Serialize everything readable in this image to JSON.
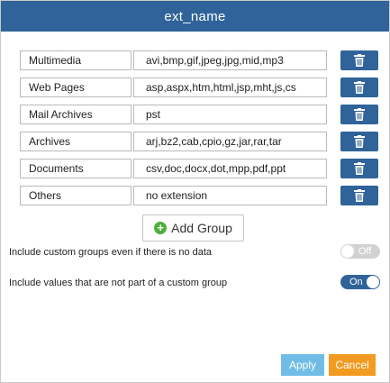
{
  "dialog": {
    "title": "ext_name"
  },
  "groups": [
    {
      "name": "Multimedia",
      "value": "avi,bmp,gif,jpeg,jpg,mid,mp3"
    },
    {
      "name": "Web Pages",
      "value": "asp,aspx,htm,html,jsp,mht,js,cs"
    },
    {
      "name": "Mail Archives",
      "value": "pst"
    },
    {
      "name": "Archives",
      "value": "arj,bz2,cab,cpio,gz,jar,rar,tar"
    },
    {
      "name": "Documents",
      "value": "csv,doc,docx,dot,mpp,pdf,ppt"
    },
    {
      "name": "Others",
      "value": "no extension"
    }
  ],
  "add_group": {
    "label": "Add Group",
    "icon": "plus-circle-icon"
  },
  "options": {
    "include_custom_groups": {
      "label": "Include custom groups even if there is no data",
      "state": "Off"
    },
    "include_values": {
      "label": "Include values that are not part of a custom group",
      "state": "On"
    }
  },
  "footer": {
    "apply_label": "Apply",
    "cancel_label": "Cancel"
  },
  "colors": {
    "header": "#2f6399",
    "delete_button": "#2f6399",
    "apply": "#6fbde6",
    "cancel": "#f29b21",
    "add_icon": "#4cae3c"
  }
}
